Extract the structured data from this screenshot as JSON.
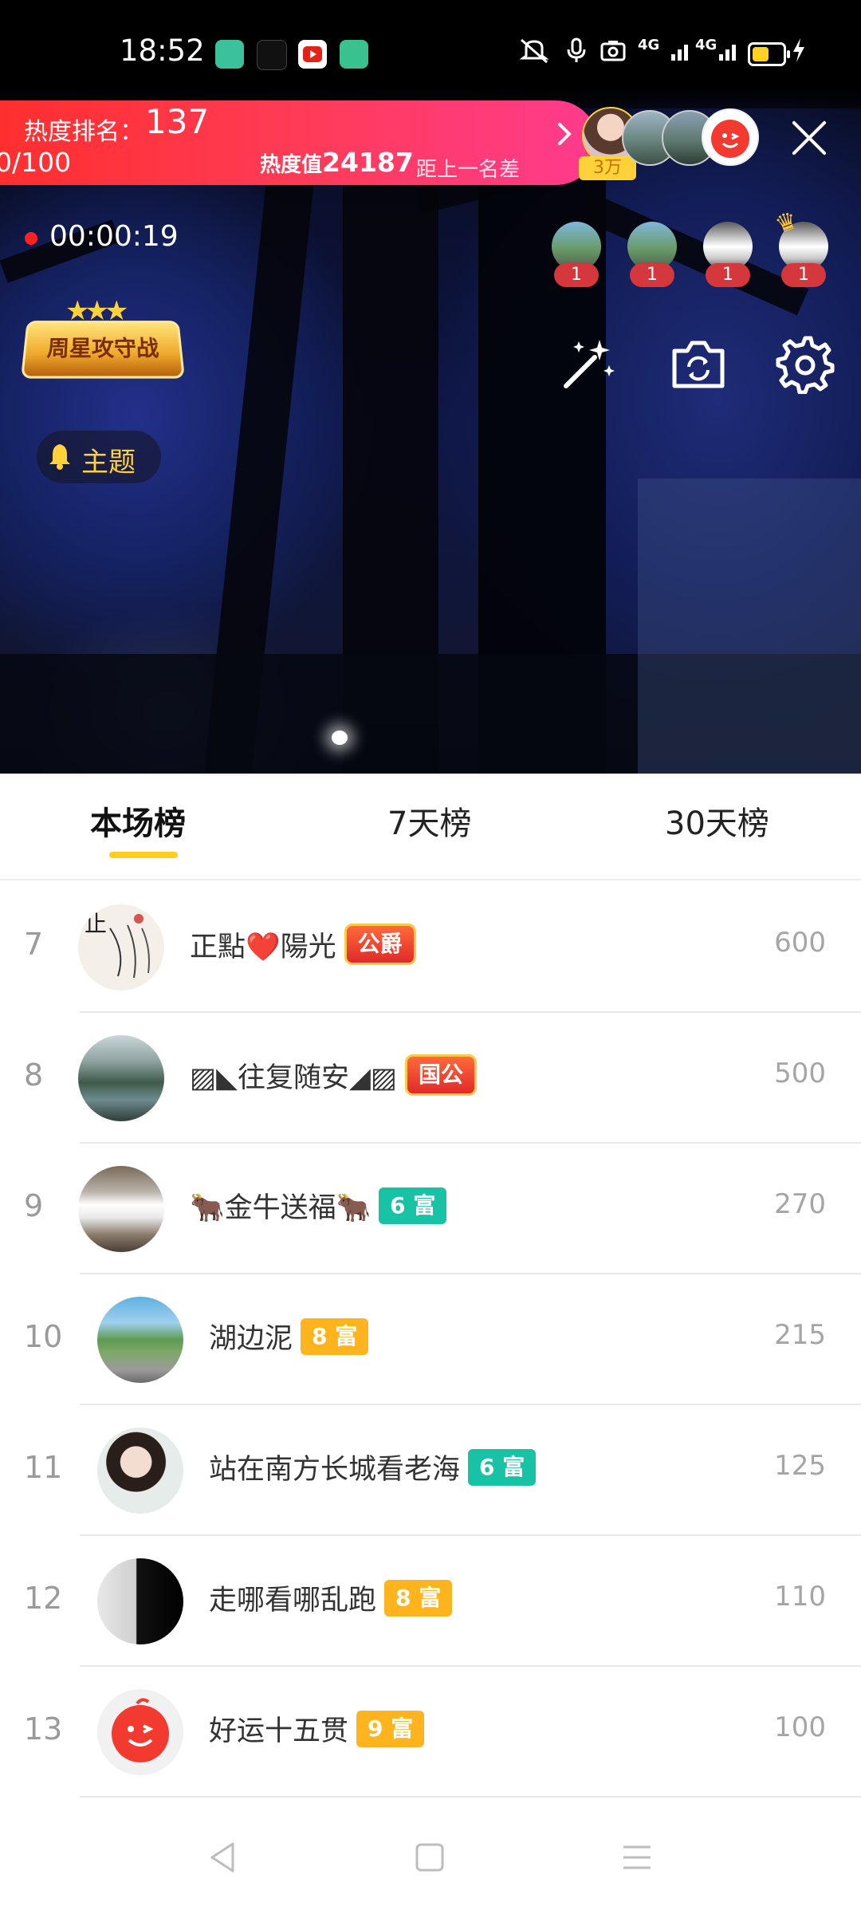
{
  "status_bar": {
    "time": "18:52",
    "network": "4G",
    "icons": [
      "mute-icon",
      "mic-icon",
      "camera-icon",
      "signal-icon",
      "battery-icon",
      "charging-icon"
    ]
  },
  "heat": {
    "label": "热度排名：",
    "rank": "137",
    "progress": "0/100",
    "value_label": "热度值",
    "value": "24187",
    "gap_label": "距上一名差"
  },
  "header": {
    "fan_count": "3万"
  },
  "live": {
    "elapsed": "00:00:19"
  },
  "viewers": [
    {
      "badge": "1"
    },
    {
      "badge": "1"
    },
    {
      "badge": "1"
    },
    {
      "badge": "1"
    }
  ],
  "event_badge": "周星攻守战",
  "topic": {
    "label": "主题"
  },
  "tabs": [
    {
      "label": "本场榜",
      "active": true
    },
    {
      "label": "7天榜",
      "active": false
    },
    {
      "label": "30天榜",
      "active": false
    }
  ],
  "ranking": [
    {
      "rank": "7",
      "name": "正點❤️陽光",
      "tag": "公爵",
      "tag_type": "noble",
      "score": "600"
    },
    {
      "rank": "8",
      "name": "▨◣往复随安◢▨",
      "tag": "国公",
      "tag_type": "noble",
      "score": "500"
    },
    {
      "rank": "9",
      "name": "🐂金牛送福🐂",
      "tag": "6 富",
      "tag_type": "rich6",
      "score": "270"
    },
    {
      "rank": "10",
      "name": "湖边泥",
      "tag": "8 富",
      "tag_type": "rich8",
      "score": "215"
    },
    {
      "rank": "11",
      "name": "站在南方长城看老海",
      "tag": "6 富",
      "tag_type": "rich6",
      "score": "125"
    },
    {
      "rank": "12",
      "name": "走哪看哪乱跑",
      "tag": "8 富",
      "tag_type": "rich8",
      "score": "110"
    },
    {
      "rank": "13",
      "name": "好运十五贯",
      "tag": "9 富",
      "tag_type": "rich9",
      "score": "100"
    }
  ],
  "colors": {
    "heat_banner_start": "#ff2f2f",
    "heat_banner_end": "#ff3b8e",
    "tab_indicator": "#ffce1f",
    "rich_gold": "#ffb41e",
    "rich_teal": "#18c2a4",
    "topic_text": "#ffd23a"
  }
}
